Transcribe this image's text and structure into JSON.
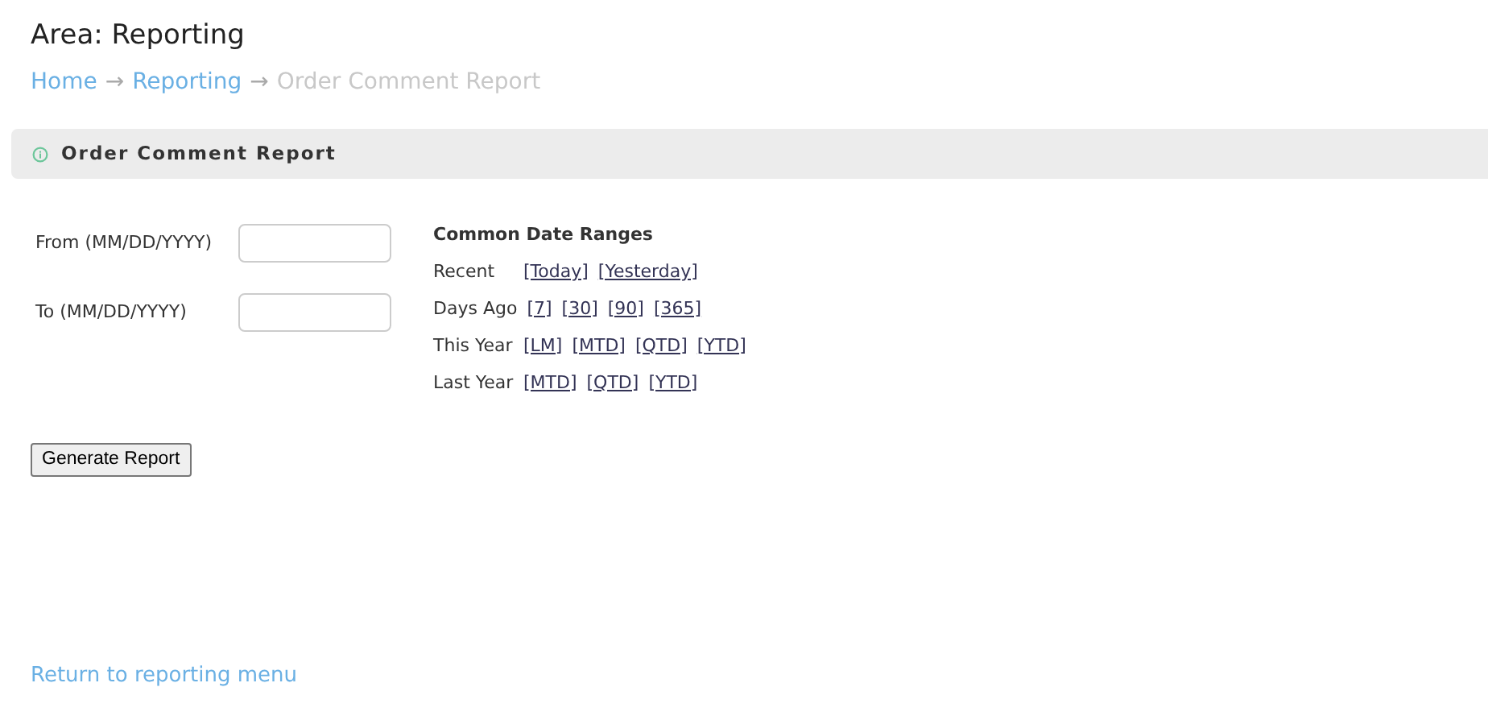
{
  "title": "Area: Reporting",
  "breadcrumb": [
    {
      "label": "Home",
      "current": false
    },
    {
      "separator": "→"
    },
    {
      "label": "Reporting",
      "current": false
    },
    {
      "separator": "→"
    },
    {
      "label": "Order Comment Report",
      "current": true
    }
  ],
  "panel": {
    "title": "Order Comment Report"
  },
  "fields": [
    {
      "label": "From (MM/DD/YYYY)"
    },
    {
      "label": "To (MM/DD/YYYY)"
    }
  ],
  "date_ranges": {
    "heading": "Common Date Ranges",
    "rows": [
      {
        "label": "Recent",
        "links": [
          "[Today]",
          "[Yesterday]"
        ]
      },
      {
        "label": "Days Ago",
        "links": [
          "[7]",
          "[30]",
          "[90]",
          "[365]"
        ]
      },
      {
        "label": "This Year",
        "links": [
          "[LM]",
          "[MTD]",
          "[QTD]",
          "[YTD]"
        ]
      },
      {
        "label": "Last Year",
        "links": [
          "[MTD]",
          "[QTD]",
          "[YTD]"
        ]
      }
    ]
  },
  "button": "Generate Report",
  "footer_link": "Return to reporting menu"
}
